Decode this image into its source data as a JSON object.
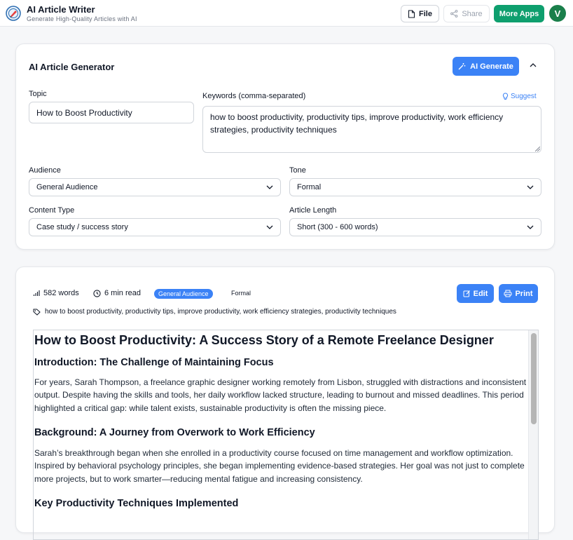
{
  "app": {
    "title": "AI Article Writer",
    "subtitle": "Generate High-Quality Articles with AI"
  },
  "toolbar": {
    "file_label": "File",
    "share_label": "Share",
    "more_apps_label": "More Apps",
    "avatar_initial": "V"
  },
  "generator": {
    "title": "AI Article Generator",
    "ai_generate_label": "AI Generate",
    "topic_label": "Topic",
    "topic_value": "How to Boost Productivity",
    "keywords_label": "Keywords (comma-separated)",
    "suggest_label": "Suggest",
    "keywords_value": "how to boost productivity, productivity tips, improve productivity, work efficiency strategies, productivity techniques",
    "audience_label": "Audience",
    "audience_value": "General Audience",
    "tone_label": "Tone",
    "tone_value": "Formal",
    "content_type_label": "Content Type",
    "content_type_value": "Case study / success story",
    "length_label": "Article Length",
    "length_value": "Short (300 - 600 words)"
  },
  "result": {
    "word_count": "582 words",
    "read_time": "6 min read",
    "audience_badge": "General Audience",
    "tone_badge": "Formal",
    "edit_label": "Edit",
    "print_label": "Print",
    "keywords_line": "how to boost productivity, productivity tips, improve productivity, work efficiency strategies, productivity techniques"
  },
  "article": {
    "title": "How to Boost Productivity: A Success Story of a Remote Freelance Designer",
    "sections": [
      {
        "heading": "Introduction: The Challenge of Maintaining Focus",
        "body": "For years, Sarah Thompson, a freelance graphic designer working remotely from Lisbon, struggled with distractions and inconsistent output. Despite having the skills and tools, her daily workflow lacked structure, leading to burnout and missed deadlines. This period highlighted a critical gap: while talent exists, sustainable productivity is often the missing piece."
      },
      {
        "heading": "Background: A Journey from Overwork to Work Efficiency",
        "body": "Sarah’s breakthrough began when she enrolled in a productivity course focused on time management and workflow optimization. Inspired by behavioral psychology principles, she began implementing evidence-based strategies. Her goal was not just to complete more projects, but to work smarter—reducing mental fatigue and increasing consistency."
      },
      {
        "heading": "Key Productivity Techniques Implemented",
        "body": ""
      }
    ]
  },
  "colors": {
    "primary": "#3b82f6",
    "green": "#0e9f6e",
    "avatar": "#1a7f4b"
  }
}
